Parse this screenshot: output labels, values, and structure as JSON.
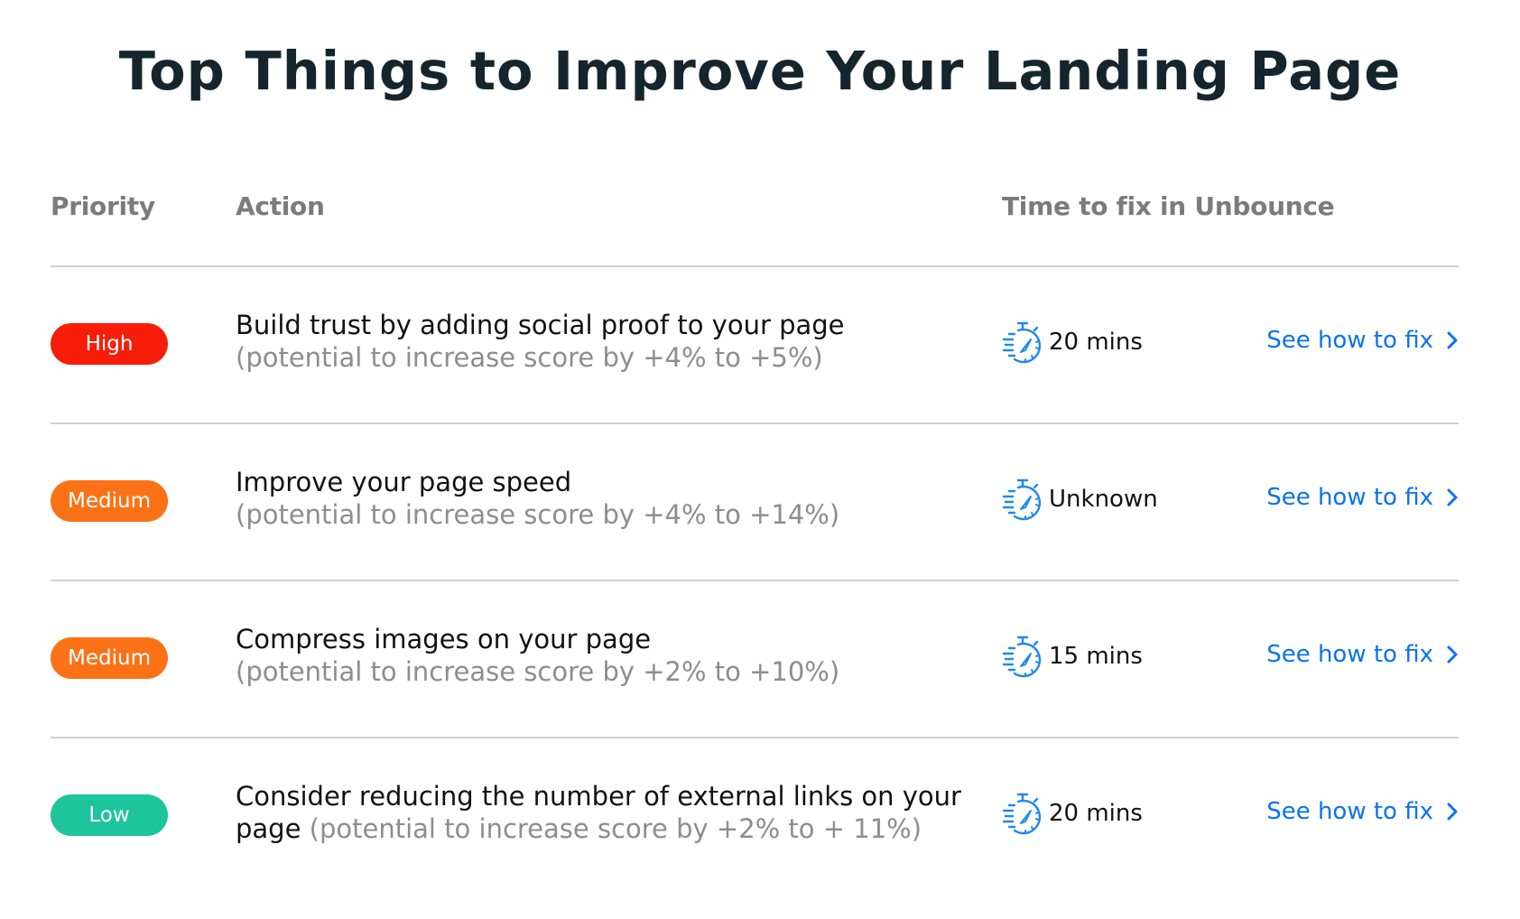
{
  "title": "Top Things to Improve Your Landing Page",
  "colors": {
    "high": "#f81d08",
    "medium": "#fb7216",
    "low": "#1ec49b",
    "link": "#0a72f0",
    "icon": "#1e88f0"
  },
  "table": {
    "headers": {
      "priority": "Priority",
      "action": "Action",
      "time": "Time to fix in Unbounce"
    },
    "rows": [
      {
        "priority": "High",
        "priority_level": "high",
        "action": "Build trust by adding social proof to your page",
        "action_break": true,
        "potential": "(potential to increase score by +4% to +5%)",
        "time_icon": "stopwatch-icon",
        "time": "20 mins",
        "link": "See how to fix",
        "link_icon": "chevron-right-icon"
      },
      {
        "priority": "Medium",
        "priority_level": "medium",
        "action": "Improve your page speed",
        "action_break": true,
        "potential": "(potential to increase score by +4% to +14%)",
        "time_icon": "stopwatch-icon",
        "time": "Unknown",
        "link": "See how to fix",
        "link_icon": "chevron-right-icon"
      },
      {
        "priority": "Medium",
        "priority_level": "medium",
        "action": "Compress images on your page",
        "action_break": true,
        "potential": "(potential to increase score by +2% to +10%)",
        "time_icon": "stopwatch-icon",
        "time": "15 mins",
        "link": "See how to fix",
        "link_icon": "chevron-right-icon"
      },
      {
        "priority": "Low",
        "priority_level": "low",
        "action": "Consider reducing the number of external links on your page",
        "action_break": false,
        "potential": "(potential to increase score by +2% to + 11%)",
        "time_icon": "stopwatch-icon",
        "time": "20 mins",
        "link": "See how to fix",
        "link_icon": "chevron-right-icon"
      }
    ]
  }
}
